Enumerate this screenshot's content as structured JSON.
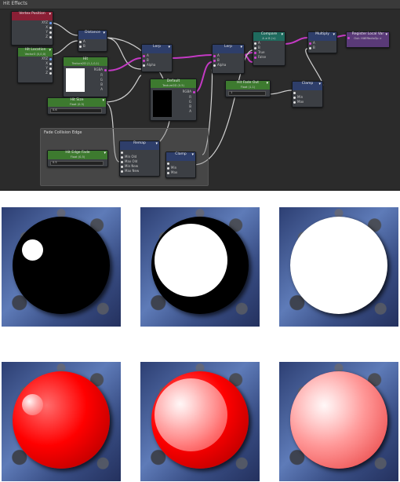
{
  "graph_title": "Hit Effects",
  "nodes": {
    "vertex_position": {
      "title": "Vertex Position",
      "ports": [
        "XYZ",
        "X",
        "Y",
        "Z"
      ]
    },
    "hit_location": {
      "title": "Hit Location",
      "sub": "Vector3 (0,0,0)",
      "ports": [
        "XYZ",
        "X",
        "Y",
        "Z"
      ]
    },
    "distance": {
      "title": "Distance",
      "ports": [
        "A",
        "B"
      ]
    },
    "hit_texture": {
      "title": "Hit",
      "sub": "Texture2D (1,1,0,1)",
      "out": "RGBA",
      "ports": [
        "R",
        "G",
        "B",
        "A"
      ]
    },
    "hit_size": {
      "title": "Hit Size",
      "sub": "Float (0.5)",
      "value": "0.6"
    },
    "lerp1": {
      "title": "Lerp",
      "ports": [
        "A",
        "B",
        "Alpha"
      ]
    },
    "lerp2": {
      "title": "Lerp",
      "ports": [
        "A",
        "B",
        "Alpha"
      ]
    },
    "default_texture": {
      "title": "Default",
      "sub": "Texture2D (0.5)",
      "out": "RGBA",
      "ports": [
        "R",
        "G",
        "B",
        "A"
      ]
    },
    "compare": {
      "title": "Compare",
      "sub": "A ≥ B (<)",
      "ports": [
        "A",
        "B",
        "True",
        "False"
      ]
    },
    "multiply": {
      "title": "Multiply",
      "ports": [
        "A",
        "B"
      ]
    },
    "register_local": {
      "title": "Register Local Var",
      "sub": "Out: HitEffectsOp >"
    },
    "hit_fade_out": {
      "title": "Hit Fade Out",
      "sub": "Float (1.1)",
      "value": "1"
    },
    "clamp1": {
      "title": "Clamp",
      "ports": [
        "",
        "Min",
        "Max"
      ]
    },
    "group_title": "Fade Collision Edge",
    "hit_edge_fade": {
      "title": "Hit Edge Fade",
      "sub": "Float (0.5)",
      "value": "0.5"
    },
    "remap": {
      "title": "Remap",
      "ports": [
        "",
        "Min Old",
        "Max Old",
        "Min New",
        "Max New"
      ]
    },
    "clamp2": {
      "title": "Clamp",
      "ports": [
        "",
        "Min",
        "Max"
      ]
    }
  },
  "colors": {
    "graph_bg": "#2b2b2b",
    "wire_magenta": "#c43ac4",
    "wire_white": "#d0d0d0",
    "header_red": "#8a1f35",
    "header_green": "#3d7a2f",
    "header_blue": "#2e3e6a",
    "header_teal": "#1f6b5e",
    "header_purple": "#5a3a78",
    "sphere_red": "#ff0000"
  },
  "spheres": [
    {
      "kind": "mask",
      "hit": 0.22
    },
    {
      "kind": "mask",
      "hit": 0.75
    },
    {
      "kind": "mask",
      "hit": 1.0
    },
    {
      "kind": "red",
      "hit": 0.22
    },
    {
      "kind": "red",
      "hit": 0.75
    },
    {
      "kind": "red",
      "hit": 1.0
    }
  ]
}
